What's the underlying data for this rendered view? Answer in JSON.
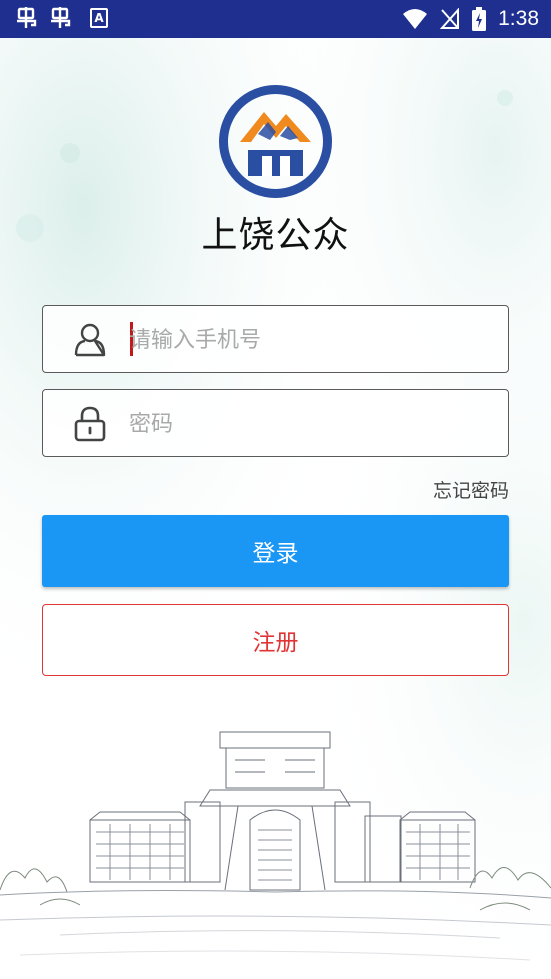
{
  "status_bar": {
    "time": "1:38",
    "left_icons": [
      "bug-icon",
      "bug-icon",
      "a-badge-icon"
    ],
    "right_icons": [
      "wifi-icon",
      "no-signal-icon",
      "battery-charging-icon"
    ]
  },
  "app": {
    "name": "上饶公众"
  },
  "login": {
    "phone_placeholder": "请输入手机号",
    "password_placeholder": "密码",
    "forgot_password": "忘记密码",
    "login_button": "登录",
    "register_button": "注册"
  },
  "colors": {
    "status_bar": "#1e2f8f",
    "primary": "#1a96f5",
    "register_accent": "#e03535",
    "logo_blue": "#2a4ea2",
    "logo_orange": "#f08a1e"
  }
}
